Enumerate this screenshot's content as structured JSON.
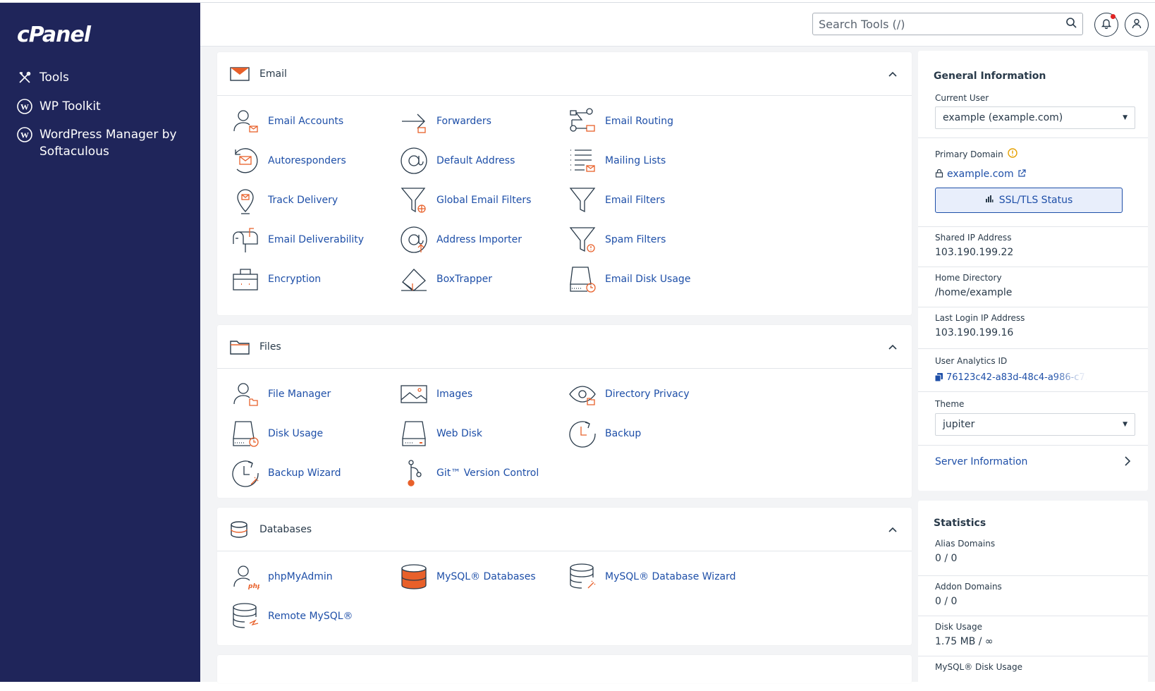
{
  "brand": {
    "logo_text": "cPanel"
  },
  "sidebar": {
    "items": [
      {
        "label": "Tools",
        "icon": "tools-icon"
      },
      {
        "label": "WP Toolkit",
        "icon": "wordpress-icon"
      },
      {
        "label": "WordPress Manager by Softaculous",
        "icon": "wordpress-icon"
      }
    ]
  },
  "header": {
    "search_placeholder": "Search Tools (/)",
    "notifications_icon": "bell-icon",
    "user_icon": "user-icon"
  },
  "colors": {
    "sidebar_bg": "#1f255a",
    "accent_orange": "#e8602a",
    "link_blue": "#1e4fa8",
    "notification_dot": "#e02424"
  },
  "sections": {
    "email": {
      "title": "Email",
      "tools": [
        "Email Accounts",
        "Forwarders",
        "Email Routing",
        "Autoresponders",
        "Default Address",
        "Mailing Lists",
        "Track Delivery",
        "Global Email Filters",
        "Email Filters",
        "Email Deliverability",
        "Address Importer",
        "Spam Filters",
        "Encryption",
        "BoxTrapper",
        "Email Disk Usage"
      ]
    },
    "files": {
      "title": "Files",
      "tools": [
        "File Manager",
        "Images",
        "Directory Privacy",
        "Disk Usage",
        "Web Disk",
        "Backup",
        "Backup Wizard",
        "Git™ Version Control"
      ]
    },
    "databases": {
      "title": "Databases",
      "tools": [
        "phpMyAdmin",
        "MySQL® Databases",
        "MySQL® Database Wizard",
        "Remote MySQL®"
      ]
    }
  },
  "general_info": {
    "title": "General Information",
    "current_user_label": "Current User",
    "current_user_value": "example (example.com)",
    "primary_domain_label": "Primary Domain",
    "primary_domain_value": "example.com",
    "ssl_button": "SSL/TLS Status",
    "shared_ip_label": "Shared IP Address",
    "shared_ip_value": "103.190.199.22",
    "home_dir_label": "Home Directory",
    "home_dir_value": "/home/example",
    "last_login_label": "Last Login IP Address",
    "last_login_value": "103.190.199.16",
    "analytics_label": "User Analytics ID",
    "analytics_value": "76123c42-a83d-48c4-a986-c7...",
    "theme_label": "Theme",
    "theme_value": "jupiter",
    "server_info": "Server Information"
  },
  "statistics": {
    "title": "Statistics",
    "items": [
      {
        "label": "Alias Domains",
        "value": "0 / 0"
      },
      {
        "label": "Addon Domains",
        "value": "0 / 0"
      },
      {
        "label": "Disk Usage",
        "value": "1.75 MB / ∞"
      },
      {
        "label": "MySQL® Disk Usage",
        "value": ""
      }
    ]
  }
}
